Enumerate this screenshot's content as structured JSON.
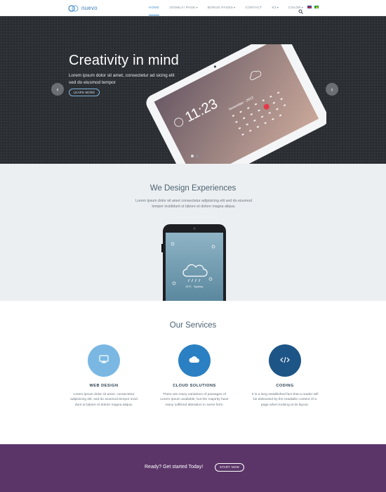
{
  "header": {
    "logo_text": "nuevo",
    "nav": [
      {
        "label": "HOME",
        "active": true,
        "has_caret": false
      },
      {
        "label": "JOOMLA! PAGE",
        "active": false,
        "has_caret": true
      },
      {
        "label": "BONUS PAGES",
        "active": false,
        "has_caret": true
      },
      {
        "label": "CONTACT",
        "active": false,
        "has_caret": false
      },
      {
        "label": "K2",
        "active": false,
        "has_caret": true
      },
      {
        "label": "COLOR",
        "active": false,
        "has_caret": true
      }
    ],
    "caret": "▾",
    "icons": {
      "search": "search-icon",
      "flag_en": "flag-uk-icon",
      "flag_pt": "flag-br-icon"
    },
    "accent": "#3d8fd0"
  },
  "hero": {
    "title": "Creativity in mind",
    "text": "Lorem ipsum dolor sit amet, consectetur ad sicing elit sed do eiusmod tempor",
    "button": "LEARN MORE",
    "arrow_left": "‹",
    "arrow_right": "›",
    "slide_count": 2,
    "active_slide": 1,
    "tablet": {
      "time": "11:23",
      "month": "November - 2013"
    },
    "background": "#2a2d31"
  },
  "experiences": {
    "title": "We Design Experiences",
    "text": "Lorem ipsum dolor sit amet consectetur adipisicing elit sed do eiusmod tempor incididunt ut labore et dolore magna aliqua.",
    "phone": {
      "temperature": "13°C",
      "city": "Sydney"
    },
    "background": "#eceff1"
  },
  "services": {
    "title": "Our Services",
    "items": [
      {
        "icon": "monitor-icon",
        "color": "#7ab8e3",
        "title": "WEB DESIGN",
        "text": "Lorem ipsum dolor sit amet, consectetur adipisicing elit, sed do eiusmod tempor incid dunt ut labore et dolore magna aliqua."
      },
      {
        "icon": "cloud-icon",
        "color": "#2a80c2",
        "title": "CLOUD SOLUTIONS",
        "text": "There are many variations of passages of Lorem Ipsum available, but the majority have many suffered alteration in some form."
      },
      {
        "icon": "code-icon",
        "color": "#1e5587",
        "title": "CODING",
        "text": "It is a long established fact that a reader will be distracted by the readable content of a page when looking at its layout."
      }
    ]
  },
  "cta": {
    "text": "Ready? Get started Today!",
    "button": "START NOW",
    "background": "#5b3568"
  }
}
